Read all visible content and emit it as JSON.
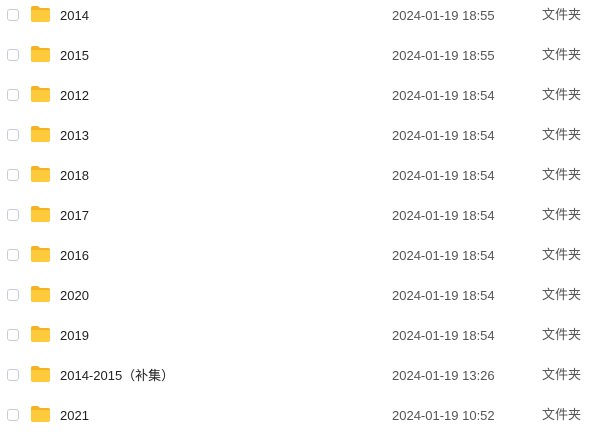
{
  "file_list": {
    "icon": "folder-icon",
    "folder_color": "#FFC83D",
    "rows": [
      {
        "name": "2014",
        "modified": "2024-01-19 18:55",
        "type": "文件夹"
      },
      {
        "name": "2015",
        "modified": "2024-01-19 18:55",
        "type": "文件夹"
      },
      {
        "name": "2012",
        "modified": "2024-01-19 18:54",
        "type": "文件夹"
      },
      {
        "name": "2013",
        "modified": "2024-01-19 18:54",
        "type": "文件夹"
      },
      {
        "name": "2018",
        "modified": "2024-01-19 18:54",
        "type": "文件夹"
      },
      {
        "name": "2017",
        "modified": "2024-01-19 18:54",
        "type": "文件夹"
      },
      {
        "name": "2016",
        "modified": "2024-01-19 18:54",
        "type": "文件夹"
      },
      {
        "name": "2020",
        "modified": "2024-01-19 18:54",
        "type": "文件夹"
      },
      {
        "name": "2019",
        "modified": "2024-01-19 18:54",
        "type": "文件夹"
      },
      {
        "name": "2014-2015（补集）",
        "modified": "2024-01-19 13:26",
        "type": "文件夹"
      },
      {
        "name": "2021",
        "modified": "2024-01-19 10:52",
        "type": "文件夹"
      }
    ]
  }
}
